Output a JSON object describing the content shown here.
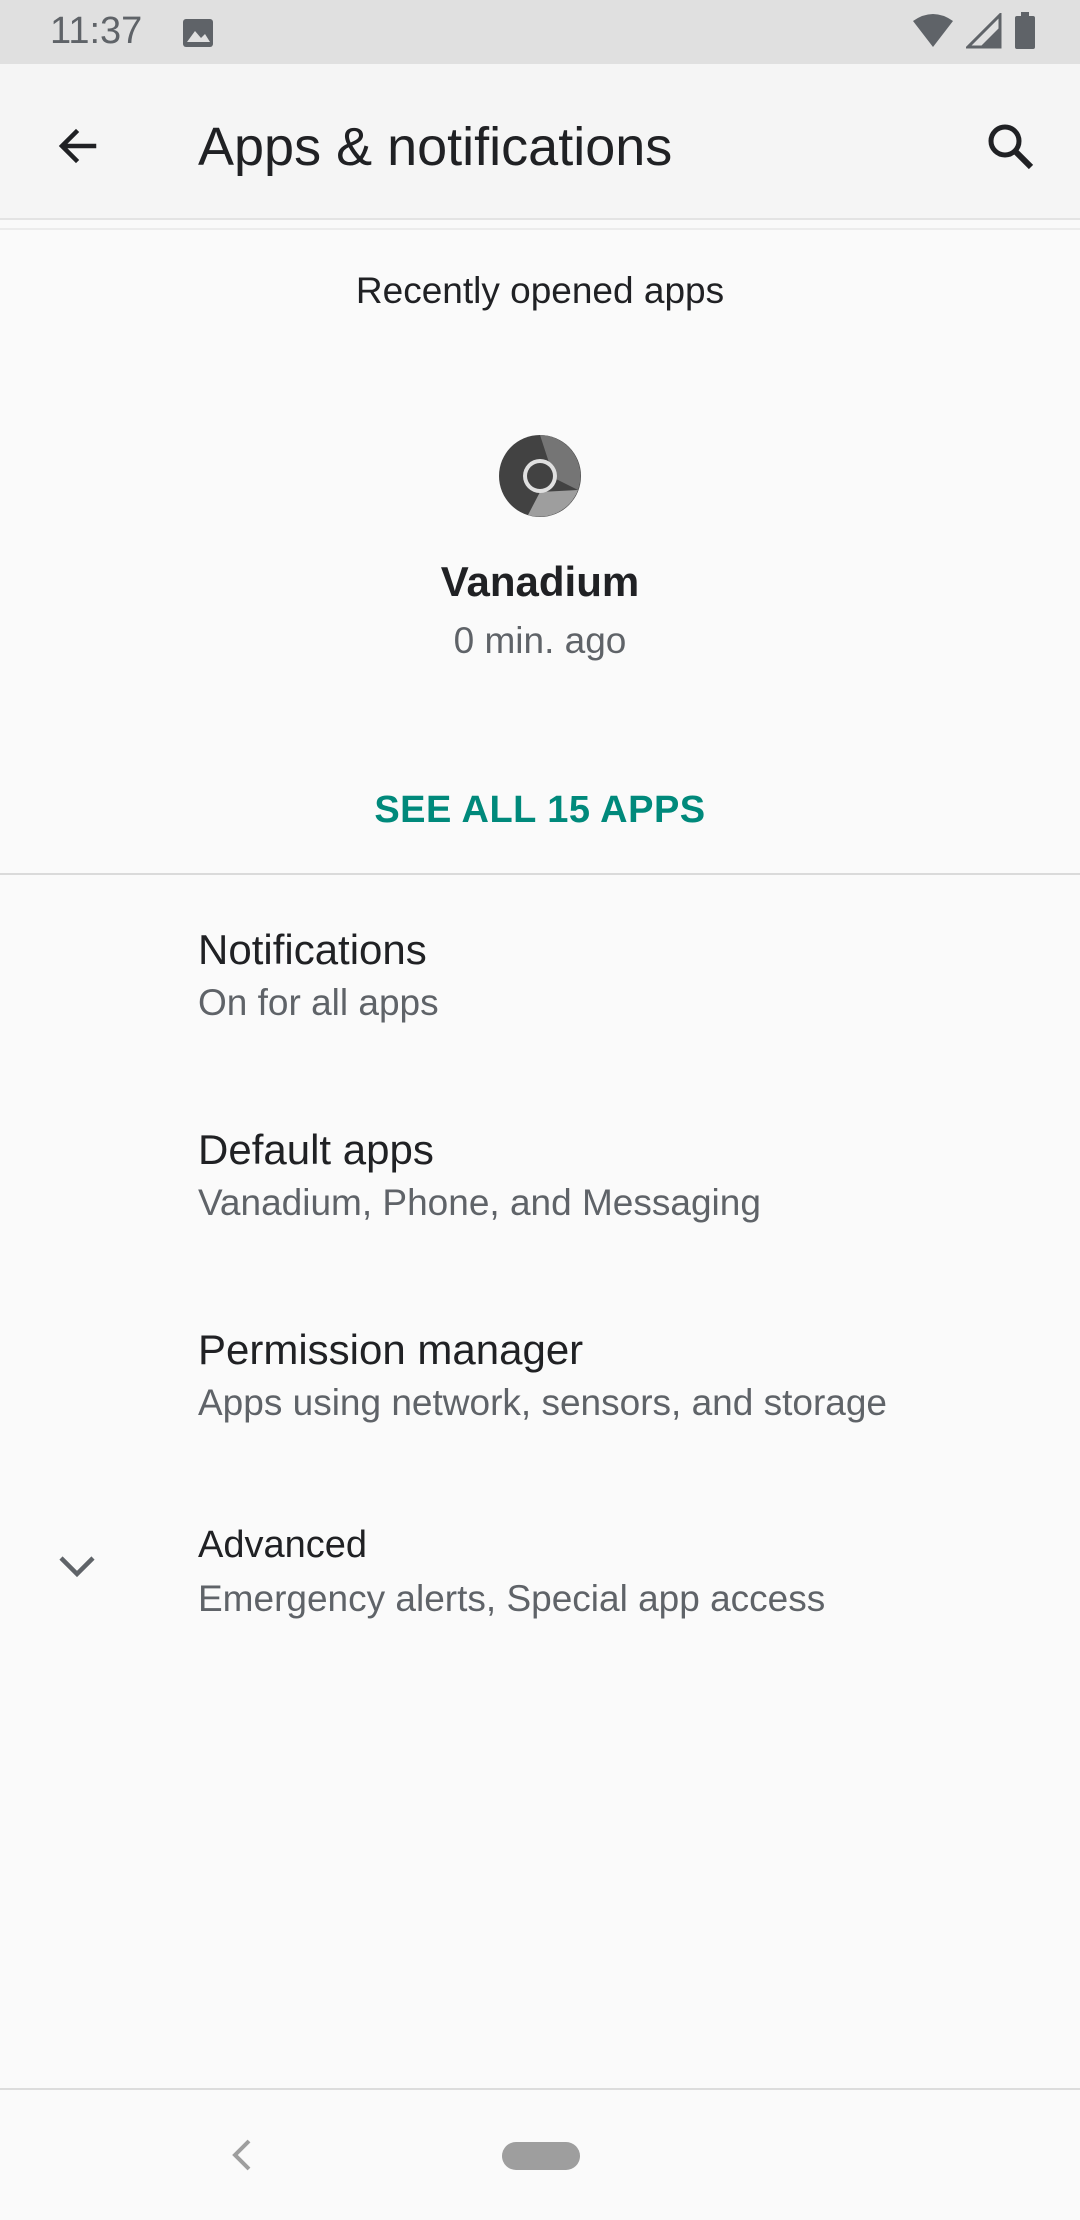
{
  "status_bar": {
    "time": "11:37"
  },
  "app_bar": {
    "title": "Apps & notifications"
  },
  "recent": {
    "heading": "Recently opened apps",
    "apps": [
      {
        "name": "Vanadium",
        "time": "0 min. ago"
      }
    ],
    "see_all_label": "SEE ALL 15 APPS"
  },
  "settings": [
    {
      "title": "Notifications",
      "summary": "On for all apps"
    },
    {
      "title": "Default apps",
      "summary": "Vanadium, Phone, and Messaging"
    },
    {
      "title": "Permission manager",
      "summary": "Apps using network, sensors, and storage"
    },
    {
      "title": "Advanced",
      "summary": "Emergency alerts, Special app access"
    }
  ],
  "colors": {
    "accent": "#00897b",
    "status_bar_bg": "#e0e0e0",
    "app_bar_bg": "#f5f5f5",
    "page_bg": "#fafafa"
  },
  "icons": {
    "status": [
      "image-icon",
      "wifi-icon",
      "cellular-signal-icon",
      "battery-icon"
    ],
    "app_bar": [
      "back-arrow-icon",
      "search-icon"
    ],
    "advanced": "chevron-down-icon",
    "nav": [
      "nav-back-icon",
      "home-pill"
    ]
  }
}
